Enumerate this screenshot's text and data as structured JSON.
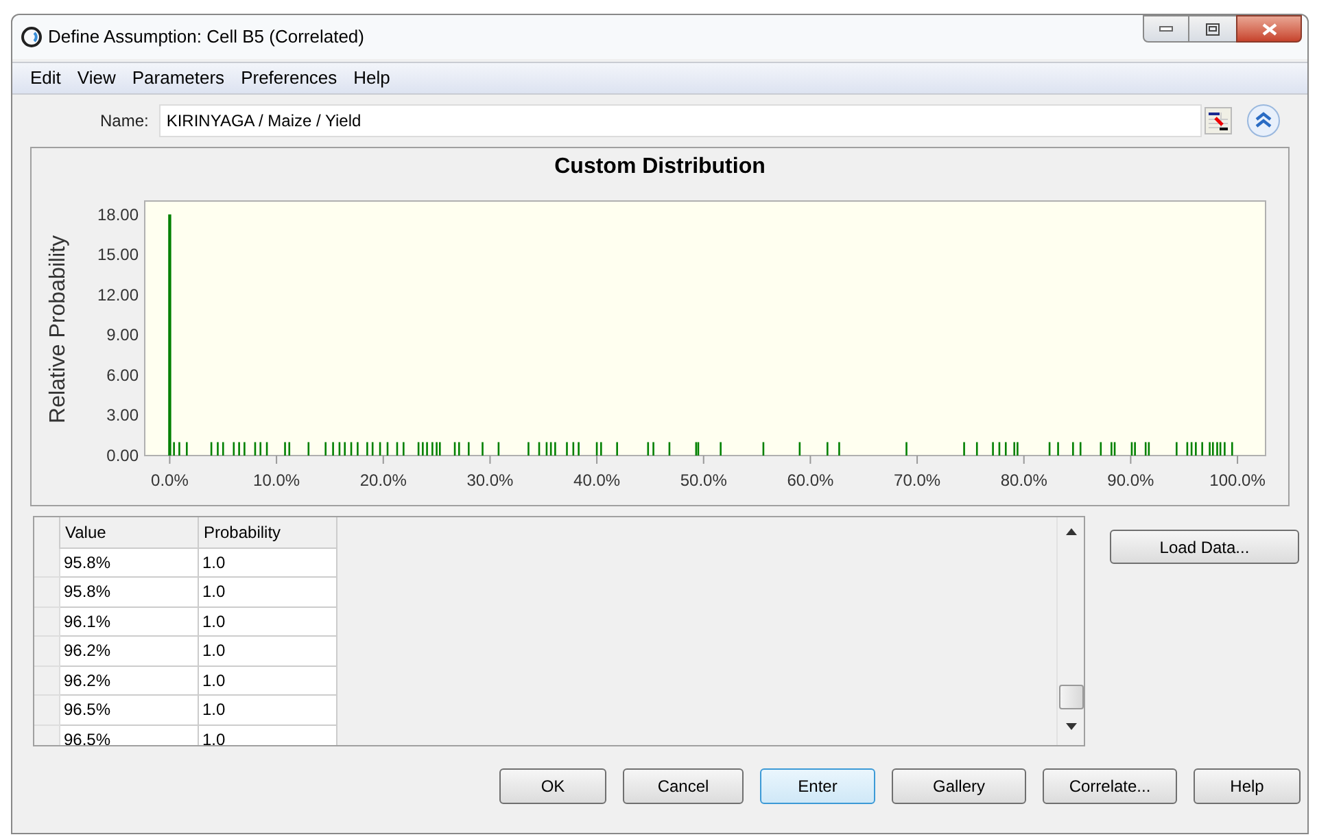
{
  "window": {
    "title": "Define Assumption: Cell B5 (Correlated)"
  },
  "menu": [
    "Edit",
    "View",
    "Parameters",
    "Preferences",
    "Help"
  ],
  "name_field": {
    "label": "Name:",
    "value": "KIRINYAGA / Maize / Yield"
  },
  "chart": {
    "chart_data": {
      "type": "bar",
      "title": "Custom Distribution",
      "ylabel": "Relative Probability",
      "x": [
        0,
        0.4,
        0.9,
        1.6,
        3.9,
        4.5,
        5.0,
        6.0,
        6.5,
        7.0,
        8.0,
        8.5,
        9.1,
        10.8,
        11.2,
        13.0,
        14.6,
        15.3,
        15.9,
        16.4,
        17.0,
        17.6,
        18.5,
        19.0,
        19.7,
        20.4,
        21.3,
        21.9,
        23.3,
        23.7,
        24.1,
        24.6,
        25.0,
        25.3,
        26.7,
        27.1,
        28.0,
        29.3,
        30.8,
        33.6,
        34.6,
        35.3,
        35.7,
        36.1,
        37.2,
        37.8,
        38.3,
        40.0,
        40.4,
        41.9,
        44.8,
        45.3,
        46.8,
        49.3,
        49.5,
        51.6,
        55.6,
        59.0,
        61.6,
        62.7,
        69.0,
        74.4,
        75.6,
        77.1,
        77.7,
        78.3,
        79.1,
        79.4,
        82.4,
        83.2,
        84.6,
        85.3,
        87.2,
        88.2,
        88.5,
        90.1,
        90.4,
        91.4,
        91.7,
        94.3,
        95.3,
        95.7,
        96.1,
        96.7,
        97.4,
        97.7,
        98.1,
        98.4,
        98.8,
        99.5
      ],
      "xlim": [
        -2.34,
        102.63
      ],
      "ylim": [
        0,
        19
      ],
      "series": [
        {
          "color": "#008000",
          "values": [
            18,
            1,
            1,
            1,
            1,
            1,
            1,
            1,
            1,
            1,
            1,
            1,
            1,
            1,
            1,
            1,
            1,
            1,
            1,
            1,
            1,
            1,
            1,
            1,
            1,
            1,
            1,
            1,
            1,
            1,
            1,
            1,
            1,
            1,
            1,
            1,
            1,
            1,
            1,
            1,
            1,
            1,
            1,
            1,
            1,
            1,
            1,
            1,
            1,
            1,
            1,
            1,
            1,
            1,
            1,
            1,
            1,
            1,
            1,
            1,
            1,
            1,
            1,
            1,
            1,
            1,
            1,
            1,
            1,
            1,
            1,
            1,
            1,
            1,
            1,
            1,
            1,
            1,
            1,
            1,
            1,
            1,
            1,
            1,
            1,
            1,
            1,
            1,
            1,
            1
          ]
        }
      ],
      "xticks": [
        {
          "value": 0,
          "label": "0.0%"
        },
        {
          "value": 10,
          "label": "10.0%"
        },
        {
          "value": 20,
          "label": "20.0%"
        },
        {
          "value": 30,
          "label": "30.0%"
        },
        {
          "value": 40,
          "label": "40.0%"
        },
        {
          "value": 50,
          "label": "50.0%"
        },
        {
          "value": 60,
          "label": "60.0%"
        },
        {
          "value": 70,
          "label": "70.0%"
        },
        {
          "value": 80,
          "label": "80.0%"
        },
        {
          "value": 90,
          "label": "90.0%"
        },
        {
          "value": 100,
          "label": "100.0%"
        }
      ],
      "yticks": [
        {
          "value": 0,
          "label": "0.00"
        },
        {
          "value": 3,
          "label": "3.00"
        },
        {
          "value": 6,
          "label": "6.00"
        },
        {
          "value": 9,
          "label": "9.00"
        },
        {
          "value": 12,
          "label": "12.00"
        },
        {
          "value": 15,
          "label": "15.00"
        },
        {
          "value": 18,
          "label": "18.00"
        }
      ]
    }
  },
  "table": {
    "columns": [
      "Value",
      "Probability"
    ],
    "rows": [
      [
        "95.8%",
        "1.0"
      ],
      [
        "95.8%",
        "1.0"
      ],
      [
        "96.1%",
        "1.0"
      ],
      [
        "96.2%",
        "1.0"
      ],
      [
        "96.2%",
        "1.0"
      ],
      [
        "96.5%",
        "1.0"
      ],
      [
        "96.5%",
        "1.0"
      ]
    ]
  },
  "load_button": "Load Data...",
  "buttons": [
    {
      "label": "OK",
      "focused": false
    },
    {
      "label": "Cancel",
      "focused": false
    },
    {
      "label": "Enter",
      "focused": true
    },
    {
      "label": "Gallery",
      "focused": false
    },
    {
      "label": "Correlate...",
      "focused": false
    },
    {
      "label": "Help",
      "focused": false
    }
  ]
}
